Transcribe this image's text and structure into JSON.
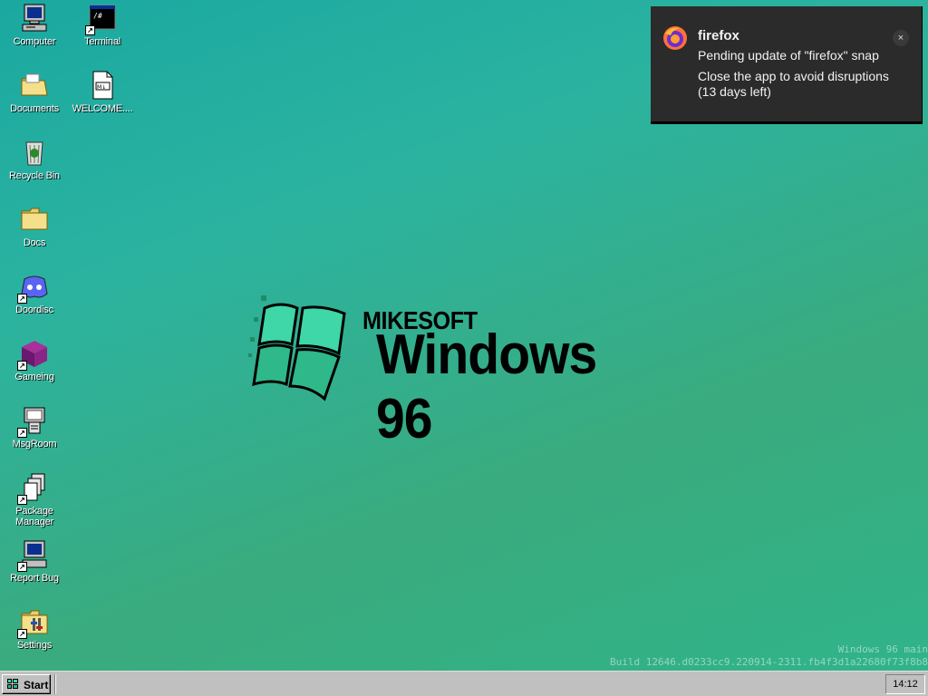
{
  "desktop": {
    "icons": [
      {
        "label": "Computer"
      },
      {
        "label": "Terminal"
      },
      {
        "label": "Documents"
      },
      {
        "label": "WELCOME...."
      },
      {
        "label": "Recycle Bin"
      },
      {
        "label": "Docs"
      },
      {
        "label": "Doordisc"
      },
      {
        "label": "Gameing"
      },
      {
        "label": "MsgRoom"
      },
      {
        "label": "Package Manager"
      },
      {
        "label": "Report Bug"
      },
      {
        "label": "Settings"
      }
    ]
  },
  "logo": {
    "top": "MIKESOFT",
    "main": "Windows 96"
  },
  "build": {
    "line1": "Windows 96 main",
    "line2": "Build 12646.d0233cc9.220914-2311.fb4f3d1a22680f73f8b8"
  },
  "notification": {
    "app": "firefox",
    "line1": "Pending update of \"firefox\" snap",
    "line2": "Close the app to avoid disruptions (13 days left)",
    "close_glyph": "×"
  },
  "taskbar": {
    "start_label": "Start",
    "clock": "14:12"
  },
  "colors": {
    "desktop_start": "#1aa8a0",
    "desktop_end": "#2fb48a",
    "taskbar": "#c0c0c0",
    "notification_bg": "#2b2b2b"
  }
}
